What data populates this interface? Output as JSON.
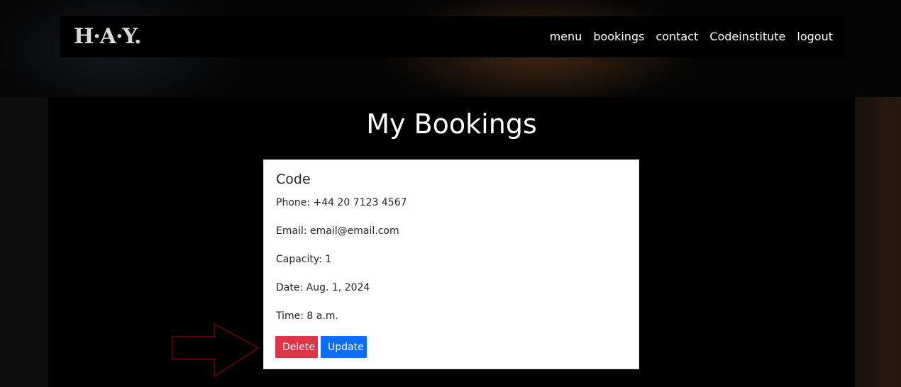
{
  "brand": {
    "logo_text": "H·A·Y."
  },
  "nav": {
    "items": [
      "menu",
      "bookings",
      "contact",
      "Codeinstitute",
      "logout"
    ]
  },
  "page": {
    "title": "My Bookings"
  },
  "booking": {
    "name": "Code",
    "phone": "Phone: +44 20 7123 4567",
    "email": "Email: email@email.com",
    "capacity": "Capacity: 1",
    "date": "Date: Aug. 1, 2024",
    "time": "Time: 8 a.m.",
    "delete_label": "Delete",
    "update_label": "Update"
  },
  "colors": {
    "delete": "#dc3545",
    "update": "#0d6efd",
    "annotation_arrow": "#8b0000"
  },
  "annotation": {
    "icon": "right-arrow-icon"
  }
}
